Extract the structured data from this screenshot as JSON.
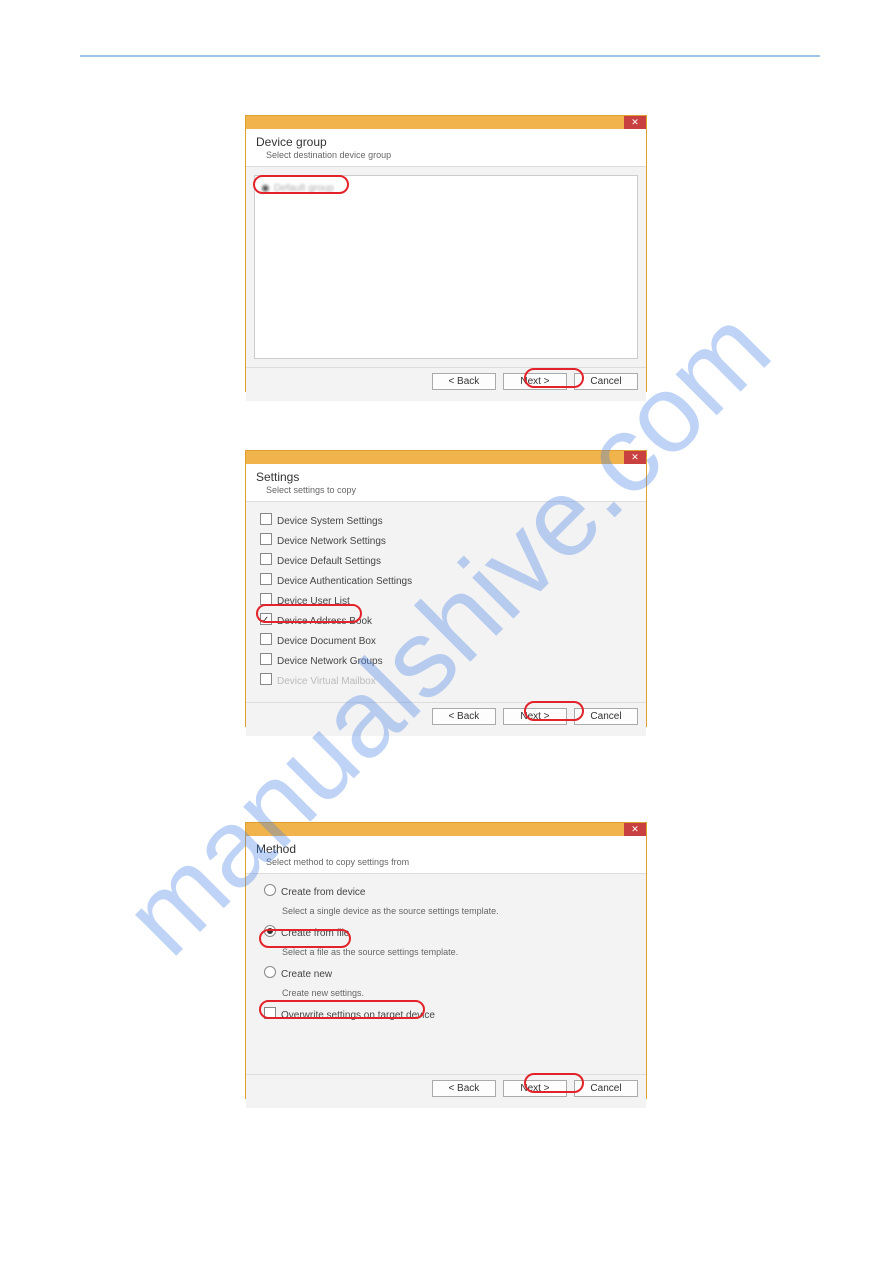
{
  "dialog1": {
    "title": "Device group",
    "subtitle": "Select destination device group",
    "radio_item": "Default group",
    "back": "< Back",
    "next": "Next >",
    "cancel": "Cancel",
    "close": "✕"
  },
  "dialog2": {
    "title": "Settings",
    "subtitle": "Select settings to copy",
    "items": [
      {
        "label": "Device System Settings",
        "checked": false,
        "disabled": false
      },
      {
        "label": "Device Network Settings",
        "checked": false,
        "disabled": false
      },
      {
        "label": "Device Default Settings",
        "checked": false,
        "disabled": false
      },
      {
        "label": "Device Authentication Settings",
        "checked": false,
        "disabled": false
      },
      {
        "label": "Device User List",
        "checked": false,
        "disabled": false
      },
      {
        "label": "Device Address Book",
        "checked": true,
        "disabled": false
      },
      {
        "label": "Device Document Box",
        "checked": false,
        "disabled": false
      },
      {
        "label": "Device Network Groups",
        "checked": false,
        "disabled": false
      },
      {
        "label": "Device Virtual Mailbox",
        "checked": false,
        "disabled": true
      }
    ],
    "back": "< Back",
    "next": "Next >",
    "cancel": "Cancel"
  },
  "dialog3": {
    "title": "Method",
    "subtitle": "Select method to copy settings from",
    "opt1_label": "Create from device",
    "opt1_desc": "Select a single device as the source settings template.",
    "opt2_label": "Create from file",
    "opt2_desc": "Select a file as the source settings template.",
    "opt3_label": "Create new",
    "opt3_desc": "Create new settings.",
    "overwrite_label": "Overwrite settings on target device",
    "back": "< Back",
    "next": "Next >",
    "cancel": "Cancel"
  },
  "watermark": "manualshive.com"
}
